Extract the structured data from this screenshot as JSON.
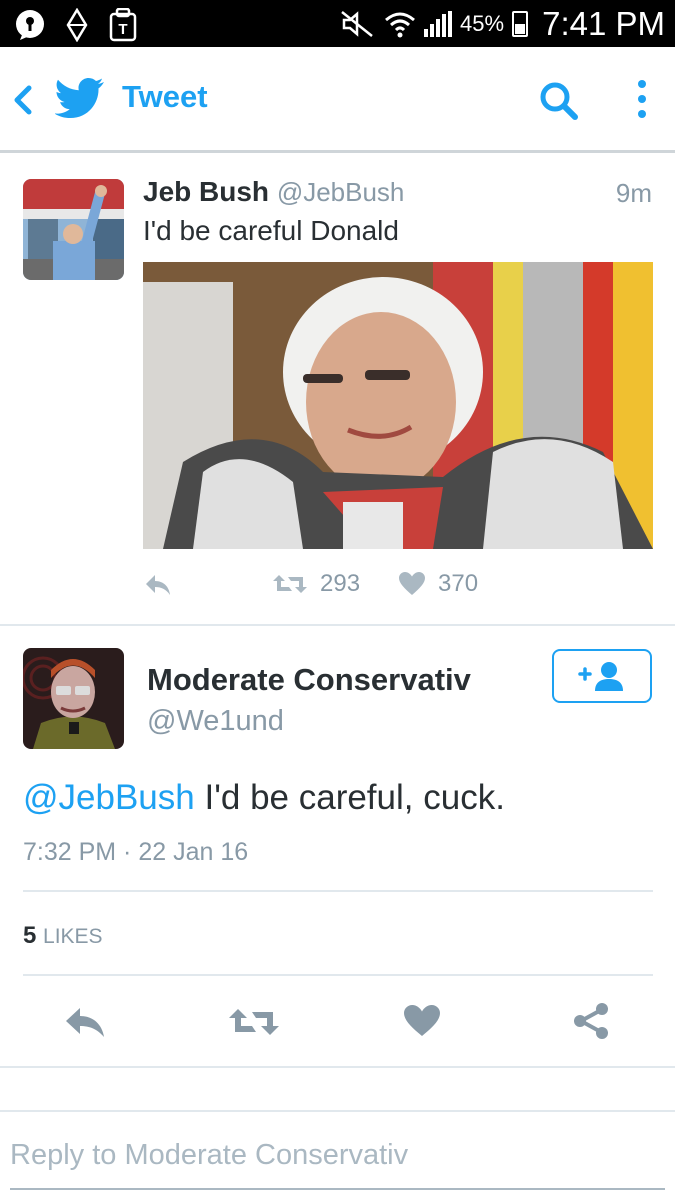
{
  "status_bar": {
    "battery": "45%",
    "time": "7:41 PM"
  },
  "app_bar": {
    "title": "Tweet"
  },
  "parent_tweet": {
    "name": "Jeb Bush",
    "handle": "@JebBush",
    "time": "9m",
    "text": "I'd be careful Donald",
    "retweets": "293",
    "likes": "370"
  },
  "main_tweet": {
    "name": "Moderate Conservativ",
    "handle": "@We1und",
    "mention": "@JebBush",
    "text": " I'd be careful, cuck.",
    "timestamp": "7:32 PM · 22 Jan 16",
    "likes_count": "5",
    "likes_label": "LIKES"
  },
  "reply": {
    "placeholder": "Reply to Moderate Conservativ"
  },
  "colors": {
    "accent": "#1da1f2",
    "muted": "#8899a6",
    "divider": "#e1e8ed"
  },
  "icons": [
    "back-chevron-icon",
    "twitter-bird-icon",
    "search-icon",
    "overflow-menu-icon",
    "reply-icon",
    "retweet-icon",
    "heart-icon",
    "share-icon",
    "follow-icon"
  ]
}
